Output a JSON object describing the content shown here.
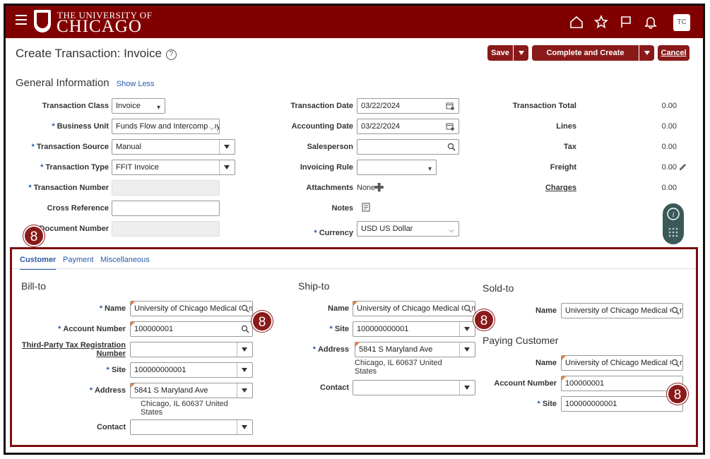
{
  "header": {
    "logo_line1": "THE UNIVERSITY OF",
    "logo_line2": "CHICAGO",
    "user_initials": "TC"
  },
  "page": {
    "title": "Create Transaction: Invoice",
    "help": "?",
    "save_label": "Save",
    "complete_label": "Complete and Create Another",
    "cancel_label": "Cancel"
  },
  "general": {
    "heading": "General Information",
    "show_less": "Show Less",
    "transaction_class": {
      "label": "Transaction Class",
      "value": "Invoice"
    },
    "business_unit": {
      "label": "Business Unit",
      "value": "Funds Flow and Intercompany"
    },
    "transaction_source": {
      "label": "Transaction Source",
      "value": "Manual"
    },
    "transaction_type": {
      "label": "Transaction Type",
      "value": "FFIT Invoice"
    },
    "transaction_number": {
      "label": "Transaction Number",
      "value": ""
    },
    "cross_reference": {
      "label": "Cross Reference",
      "value": ""
    },
    "document_number": {
      "label": "Document Number",
      "value": ""
    },
    "transaction_date": {
      "label": "Transaction Date",
      "value": "03/22/2024"
    },
    "accounting_date": {
      "label": "Accounting Date",
      "value": "03/22/2024"
    },
    "salesperson": {
      "label": "Salesperson",
      "value": ""
    },
    "invoicing_rule": {
      "label": "Invoicing Rule",
      "value": ""
    },
    "attachments": {
      "label": "Attachments",
      "value": "None"
    },
    "notes": {
      "label": "Notes"
    },
    "currency": {
      "label": "Currency",
      "value": "USD US Dollar"
    },
    "totals": [
      {
        "label": "Transaction Total",
        "value": "0.00"
      },
      {
        "label": "Lines",
        "value": "0.00"
      },
      {
        "label": "Tax",
        "value": "0.00"
      },
      {
        "label": "Freight",
        "value": "0.00"
      },
      {
        "label": "Charges",
        "value": "0.00"
      }
    ]
  },
  "callout": "8",
  "tabs": [
    "Customer",
    "Payment",
    "Miscellaneous"
  ],
  "bill_to": {
    "heading": "Bill-to",
    "name": {
      "label": "Name",
      "value": "University of Chicago Medical Center"
    },
    "account_number": {
      "label": "Account Number",
      "value": "100000001"
    },
    "tax_reg": {
      "label_line1": "Third-Party Tax Registration",
      "label_line2": "Number",
      "value": ""
    },
    "site": {
      "label": "Site",
      "value": "100000000001"
    },
    "address": {
      "label": "Address",
      "value": "5841 S Maryland Ave",
      "line2": "Chicago, IL 60637 United",
      "line3": "States"
    },
    "contact": {
      "label": "Contact",
      "value": ""
    }
  },
  "ship_to": {
    "heading": "Ship-to",
    "name": {
      "label": "Name",
      "value": "University of Chicago Medical Center"
    },
    "site": {
      "label": "Site",
      "value": "100000000001"
    },
    "address": {
      "label": "Address",
      "value": "5841 S Maryland Ave",
      "line2": "Chicago, IL 60637 United",
      "line3": "States"
    },
    "contact": {
      "label": "Contact",
      "value": ""
    }
  },
  "sold_to": {
    "heading": "Sold-to",
    "name": {
      "label": "Name",
      "value": "University of Chicago Medical Center"
    }
  },
  "paying_customer": {
    "heading": "Paying Customer",
    "name": {
      "label": "Name",
      "value": "University of Chicago Medical Center"
    },
    "account_number": {
      "label": "Account Number",
      "value": "100000001"
    },
    "site": {
      "label": "Site",
      "value": "100000000001"
    }
  },
  "colors": {
    "brand": "#800000",
    "accent": "#2a5aa8",
    "highlight": "#7a1010"
  }
}
